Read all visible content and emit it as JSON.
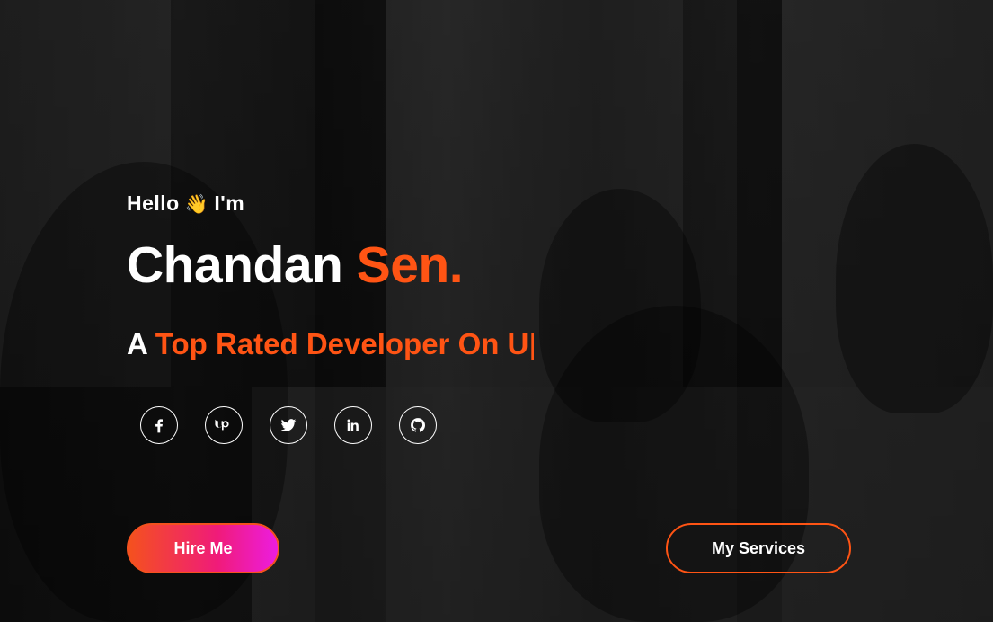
{
  "hero": {
    "greeting": "Hello",
    "greeting_emoji": "👋",
    "greeting_suffix": "I'm",
    "name_first": "Chandan",
    "name_last": "Sen.",
    "tagline_prefix": "A",
    "tagline_typed": "Top Rated Developer On U",
    "tagline_cursor": "|"
  },
  "socials": [
    {
      "icon": "facebook-icon"
    },
    {
      "icon": "upwork-icon"
    },
    {
      "icon": "twitter-icon"
    },
    {
      "icon": "linkedin-icon"
    },
    {
      "icon": "github-icon"
    }
  ],
  "buttons": {
    "hire_label": "Hire Me",
    "services_label": "My Services"
  },
  "colors": {
    "accent": "#ff5414",
    "hire_gradient_start": "#f4511e",
    "hire_gradient_end": "#ec1de0"
  }
}
